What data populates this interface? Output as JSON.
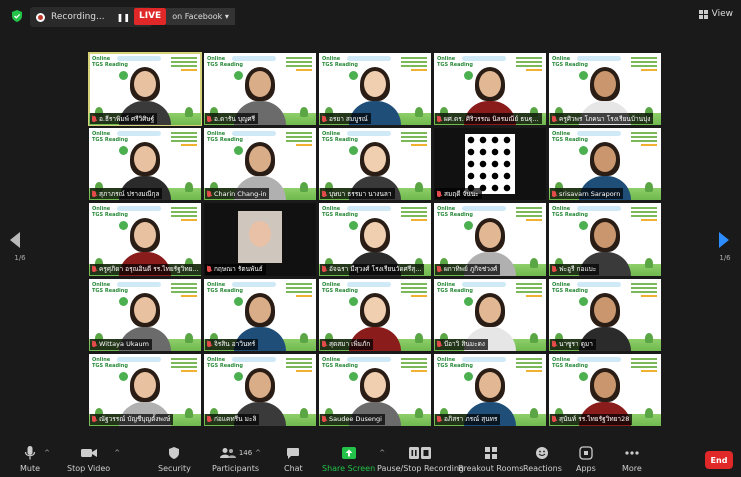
{
  "topbar": {
    "recording_label": "Recording...",
    "live_badge": "LIVE",
    "live_target": "on Facebook",
    "live_caret": "▾",
    "pause_glyph": "❚❚",
    "stop_glyph": "■",
    "view_label": "View"
  },
  "pager": {
    "left": "1/6",
    "right": "1/6"
  },
  "tiles": [
    {
      "name": "อ.ธีราพิมพ์ ศรีวิศิษฐ์",
      "active": true
    },
    {
      "name": "อ.ดารัน บุญศรี"
    },
    {
      "name": "อรยา สมบูรณ์"
    },
    {
      "name": "ผศ.ดร. ศิริวรรณ นิลรมณีย์ ธนฐุ..."
    },
    {
      "name": "ครูศิวพร โภคนา โรงเรียนบ้านบุ่ง"
    },
    {
      "name": "สุภาภรณ์ ปรางมณีกุล"
    },
    {
      "name": "Charin Chang-in"
    },
    {
      "name": "บุษบา ธรรมา นางนลา"
    },
    {
      "name": "สมฤดี จันนะ"
    },
    {
      "name": "srisavarn Saraporn"
    },
    {
      "name": "ครูศุภิดา อรุณอินดี รร.ไทยรัฐวิทย..."
    },
    {
      "name": "กฤษณา รัตนพันธ์"
    },
    {
      "name": "อัจฉรา มีสุวงศ์ โรงเรียนวัดศรีสุ..."
    },
    {
      "name": "ผกาทิพย์ ภูกิจช่วงศ์"
    },
    {
      "name": "ฟะอูรี กอแบะ"
    },
    {
      "name": "Wittaya Ukaum"
    },
    {
      "name": "จิรสิน อาวินทร์"
    },
    {
      "name": "สุดสมา เพิ่มภัก"
    },
    {
      "name": "บีอาวิ สินมะดง"
    },
    {
      "name": "นาซูรา ดูมา"
    },
    {
      "name": "ณัฐวรรณ์ บัญชีบุญตั้งพงษ์"
    },
    {
      "name": "ก่อแคทรีน มะลิ"
    },
    {
      "name": "Saudee Dusengi"
    },
    {
      "name": "อภิสรา ภรณ์ สุนทร"
    },
    {
      "name": "สุนันท์ รร.ไทยรัฐวิทยา28"
    }
  ],
  "toolbar": {
    "mute": "Mute",
    "stop_video": "Stop Video",
    "security": "Security",
    "participants": "Participants",
    "participants_count": "146",
    "chat": "Chat",
    "share_screen": "Share Screen",
    "pause_recording": "Pause/Stop Recording",
    "breakout_rooms": "Breakout Rooms",
    "reactions": "Reactions",
    "apps": "Apps",
    "more": "More",
    "end": "End",
    "caret": "^"
  },
  "background_text": {
    "line1": "Online",
    "line2": "TGS Reading"
  },
  "colors": {
    "live": "#e02828",
    "share": "#23c34a",
    "pager_active": "#2d8cff",
    "end": "#e02828",
    "mic_muted": "#e54b4b"
  }
}
